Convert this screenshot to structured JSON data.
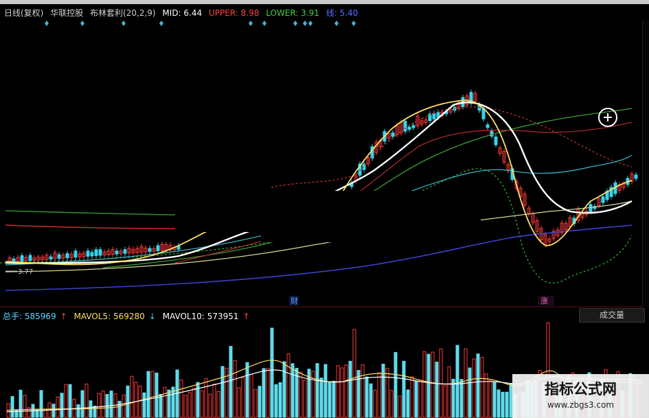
{
  "header": {
    "period": "日线(复权)",
    "stock": "华联控股",
    "indicator": "布林套利(20,2,9)",
    "mid": "MID: 6.44",
    "upper": "UPPER: 8.98",
    "lower": "LOWER: 3.91",
    "xian": "线: 5.40"
  },
  "volume_header": {
    "total": "总手: 585969",
    "mavol5": "MAVOL5: 569280",
    "mavol10": "MAVOL10: 573951"
  },
  "buttons": {
    "volume_type": "成交量"
  },
  "chart_labels": {
    "low_price": "3.77",
    "event_cai": "财",
    "event_zhang": "涨"
  },
  "watermark": {
    "title": "指标公式网",
    "url": "www.zbgs3.com"
  },
  "colors": {
    "background": "#000000",
    "up": "#ff3a3a",
    "down": "#37d3e8",
    "mid_line": "#ffffff",
    "upper_line": "#c83030",
    "lower_line": "#2a7a2a",
    "yellow_line": "#ffe066"
  },
  "chart_data": {
    "type": "line",
    "title": "布林套利(20,2,9)",
    "series": [
      {
        "name": "MID",
        "last": 6.44
      },
      {
        "name": "UPPER",
        "last": 8.98
      },
      {
        "name": "LOWER",
        "last": 3.91
      },
      {
        "name": "线",
        "last": 5.4
      }
    ],
    "low_marker": 3.77,
    "volume": {
      "total": 585969,
      "mavol5": 569280,
      "mavol10": 573951
    }
  }
}
